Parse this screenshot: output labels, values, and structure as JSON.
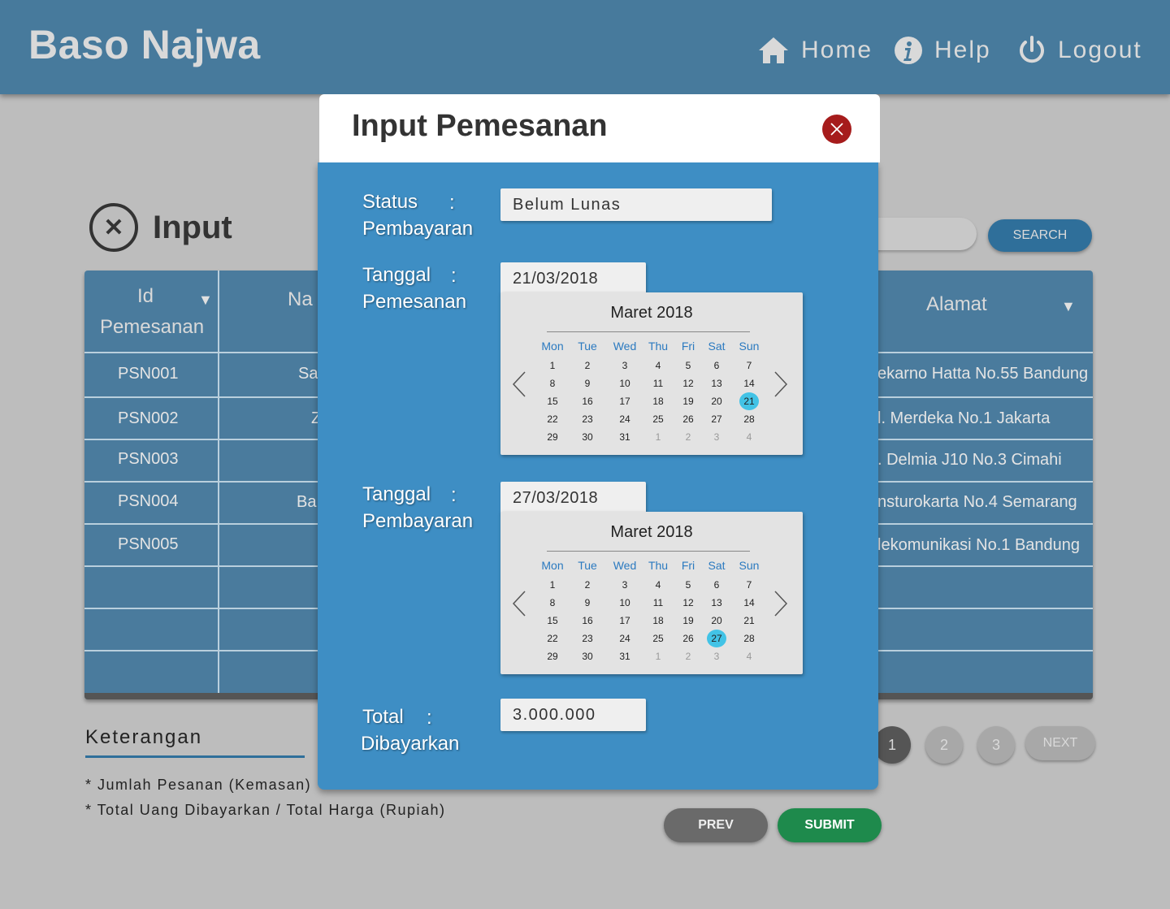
{
  "header": {
    "brand": "Baso Najwa",
    "nav": [
      {
        "label": "Home",
        "icon": "home-icon"
      },
      {
        "label": "Help",
        "icon": "info-icon"
      },
      {
        "label": "Logout",
        "icon": "power-icon"
      }
    ]
  },
  "page": {
    "title_icon": "close-circle-icon",
    "title": "Input",
    "search_label": "SEARCH"
  },
  "table": {
    "headers": {
      "id_line1": "Id",
      "id_line2": "Pemesanan",
      "nama": "Na",
      "alamat": "Alamat"
    },
    "rows": [
      {
        "id": "PSN001",
        "nama": "Sa",
        "alamat": "ekarno Hatta No.55 Bandung"
      },
      {
        "id": "PSN002",
        "nama": "Z",
        "alamat": "l. Merdeka No.1 Jakarta"
      },
      {
        "id": "PSN003",
        "nama": "",
        "alamat": ". Delmia J10 No.3 Cimahi"
      },
      {
        "id": "PSN004",
        "nama": "Ba",
        "alamat": "nsturokarta No.4 Semarang"
      },
      {
        "id": "PSN005",
        "nama": "",
        "alamat": "lekomunikasi No.1 Bandung"
      }
    ]
  },
  "keterangan": {
    "title": "Keterangan",
    "notes": [
      "* Jumlah Pesanan (Kemasan)",
      "* Total Uang Dibayarkan / Total Harga (Rupiah)"
    ]
  },
  "pagination": {
    "pages": [
      "1",
      "2",
      "3"
    ],
    "next": "NEXT"
  },
  "buttons": {
    "prev": "PREV",
    "submit": "SUBMIT"
  },
  "modal": {
    "title": "Input Pemesanan",
    "colon": ":",
    "status": {
      "label1": "Status",
      "label2": "Pembayaran",
      "value": "Belum Lunas"
    },
    "tanggal_pemesanan": {
      "label1": "Tanggal",
      "label2": "Pemesanan",
      "value": "21/03/2018"
    },
    "tanggal_pembayaran": {
      "label1": "Tanggal",
      "label2": "Pembayaran",
      "value": "27/03/2018"
    },
    "total": {
      "label1": "Total",
      "label2": "Dibayarkan",
      "value": "3.000.000"
    },
    "calendars": [
      {
        "month": "Maret 2018",
        "selected": "21"
      },
      {
        "month": "Maret 2018",
        "selected": "27"
      }
    ],
    "weekdays": [
      "Mon",
      "Tue",
      "Wed",
      "Thu",
      "Fri",
      "Sat",
      "Sun"
    ],
    "weeks": [
      [
        "1",
        "2",
        "3",
        "4",
        "5",
        "6",
        "7"
      ],
      [
        "8",
        "9",
        "10",
        "11",
        "12",
        "13",
        "14"
      ],
      [
        "15",
        "16",
        "17",
        "18",
        "19",
        "20",
        "21"
      ],
      [
        "22",
        "23",
        "24",
        "25",
        "26",
        "27",
        "28"
      ],
      [
        "29",
        "30",
        "31",
        "1",
        "2",
        "3",
        "4"
      ]
    ]
  }
}
